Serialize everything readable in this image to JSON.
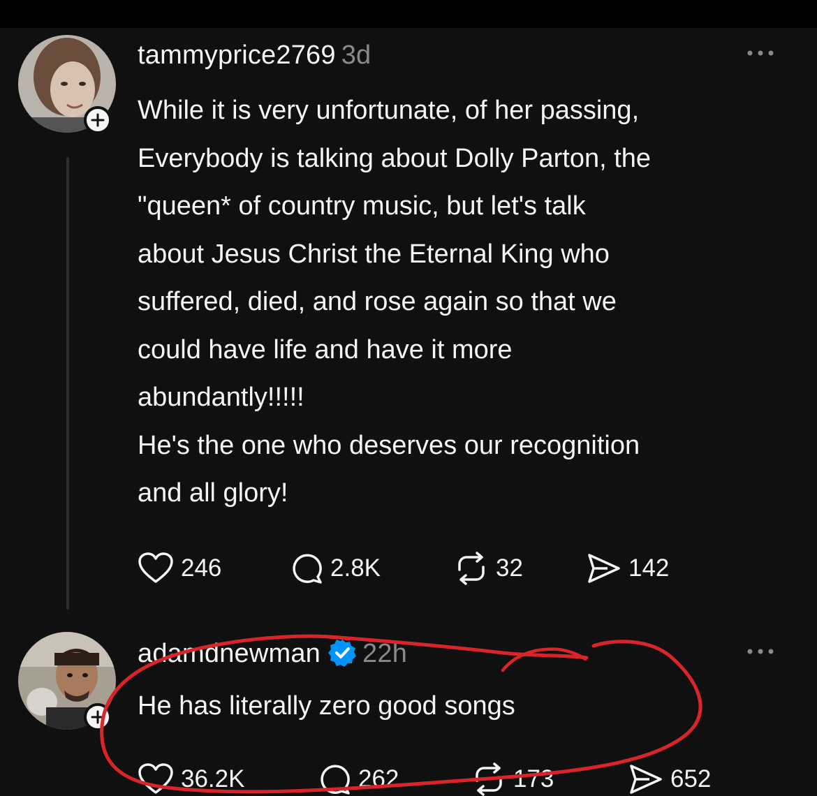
{
  "post1": {
    "username": "tammyprice2769",
    "time": "3d",
    "text": "While it is very unfortunate, of her passing,\nEverybody is talking about Dolly Parton, the\n\"queen* of country music, but let's talk\nabout Jesus Christ the Eternal King who\nsuffered, died, and rose again so that we\ncould have life and have it more\nabundantly!!!!!\nHe's the one who deserves our recognition\nand all glory!",
    "likes": "246",
    "replies": "2.8K",
    "reposts": "32",
    "shares": "142"
  },
  "post2": {
    "username": "adamdnewman",
    "time": "22h",
    "verified": true,
    "text": "He has literally zero good songs",
    "likes": "36.2K",
    "replies": "262",
    "reposts": "173",
    "shares": "652"
  },
  "icons": {
    "like": "heart-icon",
    "reply": "comment-icon",
    "repost": "repost-icon",
    "share": "send-icon",
    "more": "more-dots-icon",
    "follow": "plus-icon",
    "verified": "verified-badge-icon"
  },
  "colors": {
    "background": "#101010",
    "text": "#f3f5f7",
    "muted": "#8a8a8a",
    "verified": "#0095f6",
    "annotation": "#d9252a"
  }
}
